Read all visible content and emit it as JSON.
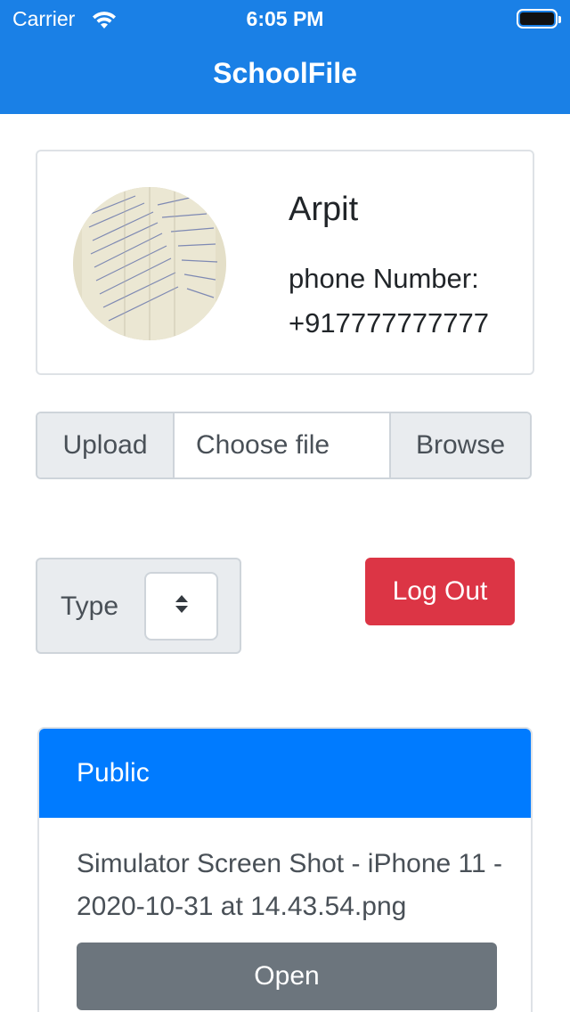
{
  "status_bar": {
    "carrier": "Carrier",
    "time": "6:05 PM"
  },
  "nav": {
    "title": "SchoolFile"
  },
  "profile": {
    "name": "Arpit",
    "phone_label": "phone Number:",
    "phone_value": "+917777777777"
  },
  "upload": {
    "label": "Upload",
    "placeholder": "Choose file",
    "browse": "Browse"
  },
  "type_select": {
    "label": "Type"
  },
  "logout": {
    "label": "Log Out"
  },
  "public_section": {
    "header": "Public",
    "files": [
      {
        "name": "Simulator Screen Shot - iPhone 11 - 2020-10-31 at 14.43.54.png",
        "open_label": "Open"
      }
    ]
  },
  "colors": {
    "nav_bar": "#1a80e6",
    "danger": "#dc3545",
    "primary": "#007bff",
    "secondary": "#6c757d"
  },
  "icons": [
    "wifi-icon",
    "battery-icon",
    "select-chevron-icon"
  ]
}
